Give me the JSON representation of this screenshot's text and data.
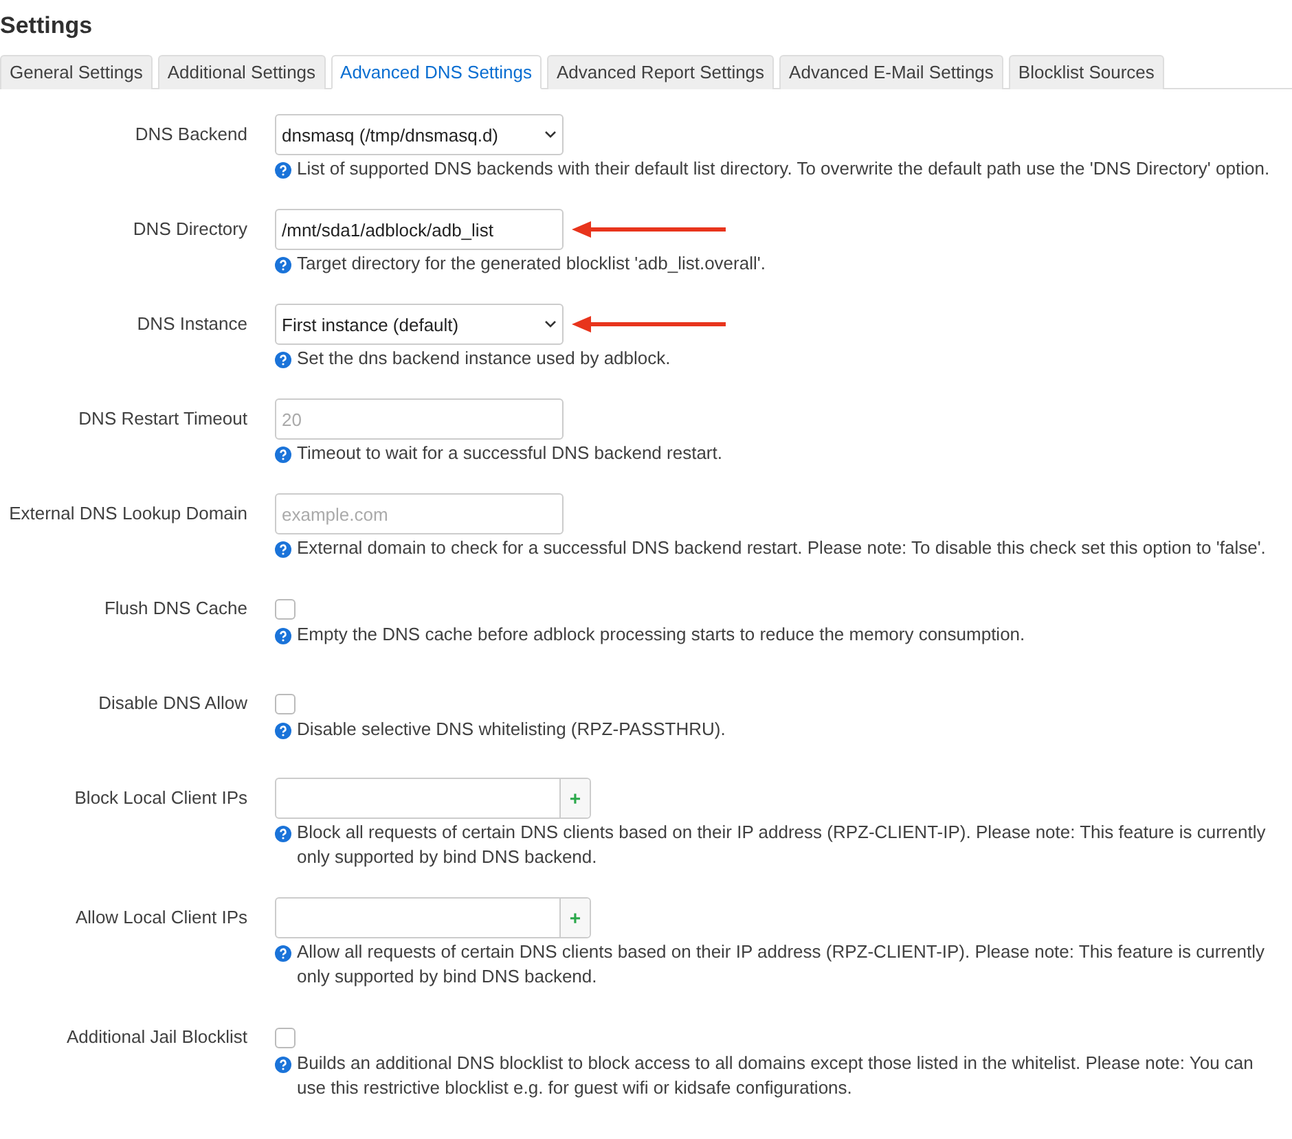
{
  "title": "Settings",
  "tabs": [
    {
      "label": "General Settings",
      "selected": false
    },
    {
      "label": "Additional Settings",
      "selected": false
    },
    {
      "label": "Advanced DNS Settings",
      "selected": true
    },
    {
      "label": "Advanced Report Settings",
      "selected": false
    },
    {
      "label": "Advanced E-Mail Settings",
      "selected": false
    },
    {
      "label": "Blocklist Sources",
      "selected": false
    }
  ],
  "options": [
    {
      "kind": "select",
      "label": "DNS Backend",
      "value": "dnsmasq (/tmp/dnsmasq.d)",
      "arrow": false,
      "description": "List of supported DNS backends with their default list directory. To overwrite the default path use the 'DNS Directory' option."
    },
    {
      "kind": "text",
      "label": "DNS Directory",
      "value": "/mnt/sda1/adblock/adb_list",
      "arrow": true,
      "description": "Target directory for the generated blocklist 'adb_list.overall'."
    },
    {
      "kind": "select",
      "label": "DNS Instance",
      "value": "First instance (default)",
      "arrow": true,
      "description": "Set the dns backend instance used by adblock."
    },
    {
      "kind": "text",
      "label": "DNS Restart Timeout",
      "placeholder": "20",
      "arrow": false,
      "description": "Timeout to wait for a successful DNS backend restart."
    },
    {
      "kind": "text",
      "label": "External DNS Lookup Domain",
      "placeholder": "example.com",
      "arrow": false,
      "description": "External domain to check for a successful DNS backend restart. Please note: To disable this check set this option to 'false'."
    },
    {
      "kind": "checkbox",
      "label": "Flush DNS Cache",
      "checked": false,
      "arrow": false,
      "description": "Empty the DNS cache before adblock processing starts to reduce the memory consumption."
    },
    {
      "kind": "checkbox",
      "label": "Disable DNS Allow",
      "checked": false,
      "arrow": false,
      "description": "Disable selective DNS whitelisting (RPZ-PASSTHRU)."
    },
    {
      "kind": "list",
      "label": "Block Local Client IPs",
      "add": "+",
      "arrow": false,
      "description": "Block all requests of certain DNS clients based on their IP address (RPZ-CLIENT-IP). Please note: This feature is currently only supported by bind DNS backend."
    },
    {
      "kind": "list",
      "label": "Allow Local Client IPs",
      "add": "+",
      "arrow": false,
      "description": "Allow all requests of certain DNS clients based on their IP address (RPZ-CLIENT-IP). Please note: This feature is currently only supported by bind DNS backend."
    },
    {
      "kind": "checkbox",
      "label": "Additional Jail Blocklist",
      "checked": false,
      "arrow": false,
      "description": "Builds an additional DNS blocklist to block access to all domains except those listed in the whitelist. Please note: You can use this restrictive blocklist e.g. for guest wifi or kidsafe configurations."
    }
  ]
}
